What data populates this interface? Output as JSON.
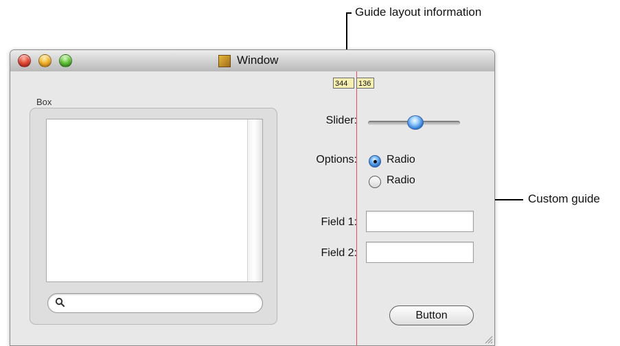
{
  "annotations": {
    "guide_layout_information": "Guide layout information",
    "custom_guide": "Custom guide"
  },
  "window": {
    "title": "Window",
    "icons": {
      "window": "window-icon",
      "close": "close-icon",
      "minimize": "minimize-icon",
      "zoom": "zoom-icon",
      "search": "search-icon",
      "resize": "resize-grip-icon"
    },
    "left_panel": {
      "box_label": "Box",
      "search_placeholder": ""
    },
    "guide_measurements": {
      "left": "344",
      "right": "136"
    },
    "controls": {
      "slider_label": "Slider:",
      "slider_value": 0.48,
      "options_label": "Options:",
      "radio_1": "Radio",
      "radio_2": "Radio",
      "field_1_label": "Field 1:",
      "field_1_value": "",
      "field_2_label": "Field 2:",
      "field_2_value": "",
      "button_label": "Button"
    }
  },
  "colors": {
    "guide": "#e84d56",
    "measure_background": "#f7efb1",
    "window_background": "#e8e8e8"
  }
}
